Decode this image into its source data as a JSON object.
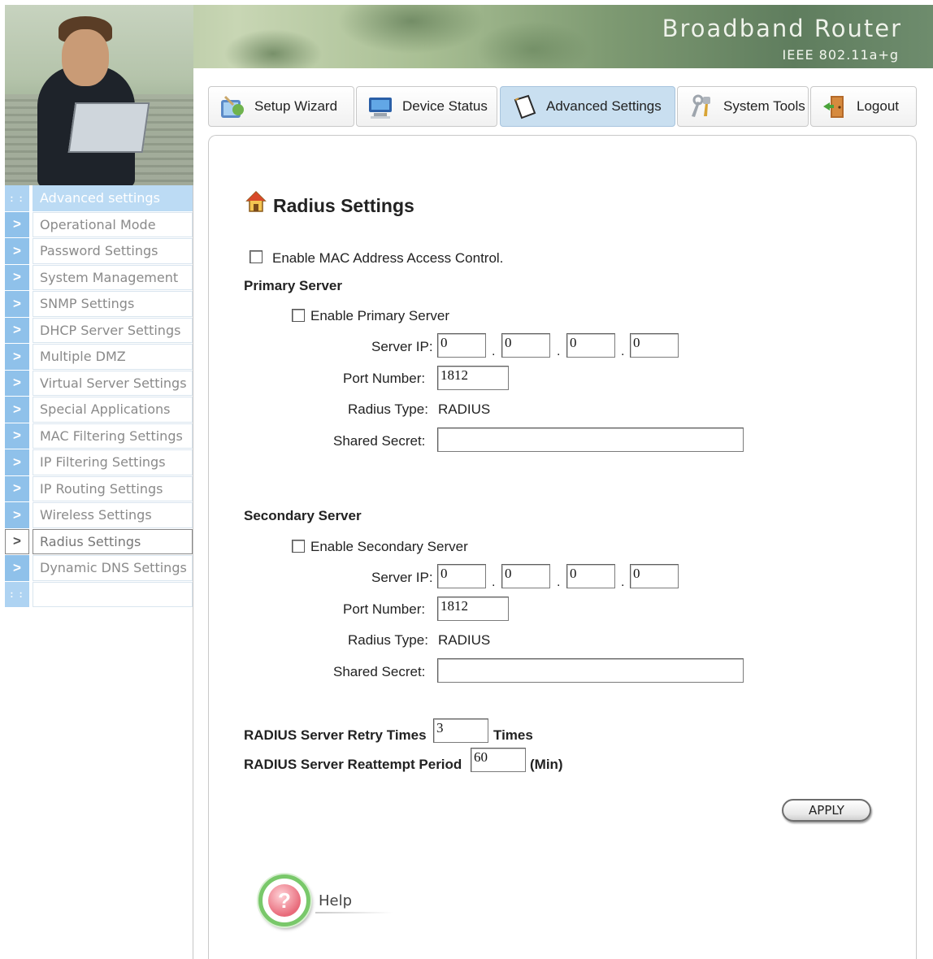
{
  "header": {
    "brand_title": "Broadband Router",
    "brand_subtitle": "IEEE 802.11a+g"
  },
  "tabs": [
    {
      "label": "Setup Wizard",
      "icon": "setup-wizard-icon",
      "active": false
    },
    {
      "label": "Device Status",
      "icon": "monitor-icon",
      "active": false
    },
    {
      "label": "Advanced Settings",
      "icon": "document-icon",
      "active": true
    },
    {
      "label": "System Tools",
      "icon": "tools-icon",
      "active": false
    },
    {
      "label": "Logout",
      "icon": "door-exit-icon",
      "active": false
    }
  ],
  "sidebar": {
    "header": "Advanced settings",
    "items": [
      {
        "label": "Operational Mode"
      },
      {
        "label": "Password Settings"
      },
      {
        "label": "System Management"
      },
      {
        "label": "SNMP Settings"
      },
      {
        "label": "DHCP Server Settings"
      },
      {
        "label": "Multiple DMZ"
      },
      {
        "label": "Virtual Server Settings"
      },
      {
        "label": "Special Applications"
      },
      {
        "label": "MAC Filtering Settings"
      },
      {
        "label": "IP Filtering Settings"
      },
      {
        "label": "IP Routing Settings"
      },
      {
        "label": "Wireless Settings"
      },
      {
        "label": "Radius Settings"
      },
      {
        "label": "Dynamic DNS Settings"
      }
    ],
    "current": "Radius Settings"
  },
  "page": {
    "title": "Radius Settings",
    "enable_mac_label": "Enable MAC Address Access Control.",
    "enable_mac_checked": false
  },
  "primary": {
    "heading": "Primary Server",
    "enable_label": "Enable Primary Server",
    "enable_checked": false,
    "server_ip_label": "Server IP:",
    "ip": [
      "0",
      "0",
      "0",
      "0"
    ],
    "port_label": "Port Number:",
    "port": "1812",
    "radius_type_label": "Radius Type:",
    "radius_type": "RADIUS",
    "secret_label": "Shared Secret:",
    "secret": ""
  },
  "secondary": {
    "heading": "Secondary Server",
    "enable_label": "Enable Secondary Server",
    "enable_checked": false,
    "server_ip_label": "Server IP:",
    "ip": [
      "0",
      "0",
      "0",
      "0"
    ],
    "port_label": "Port Number:",
    "port": "1812",
    "radius_type_label": "Radius Type:",
    "radius_type": "RADIUS",
    "secret_label": "Shared Secret:",
    "secret": ""
  },
  "retry": {
    "label": "RADIUS Server Retry Times",
    "value": "3",
    "unit": "Times"
  },
  "reattempt": {
    "label": "RADIUS Server Reattempt Period",
    "value": "60",
    "unit": "(Min)"
  },
  "actions": {
    "apply_label": "APPLY",
    "help_label": "Help"
  }
}
